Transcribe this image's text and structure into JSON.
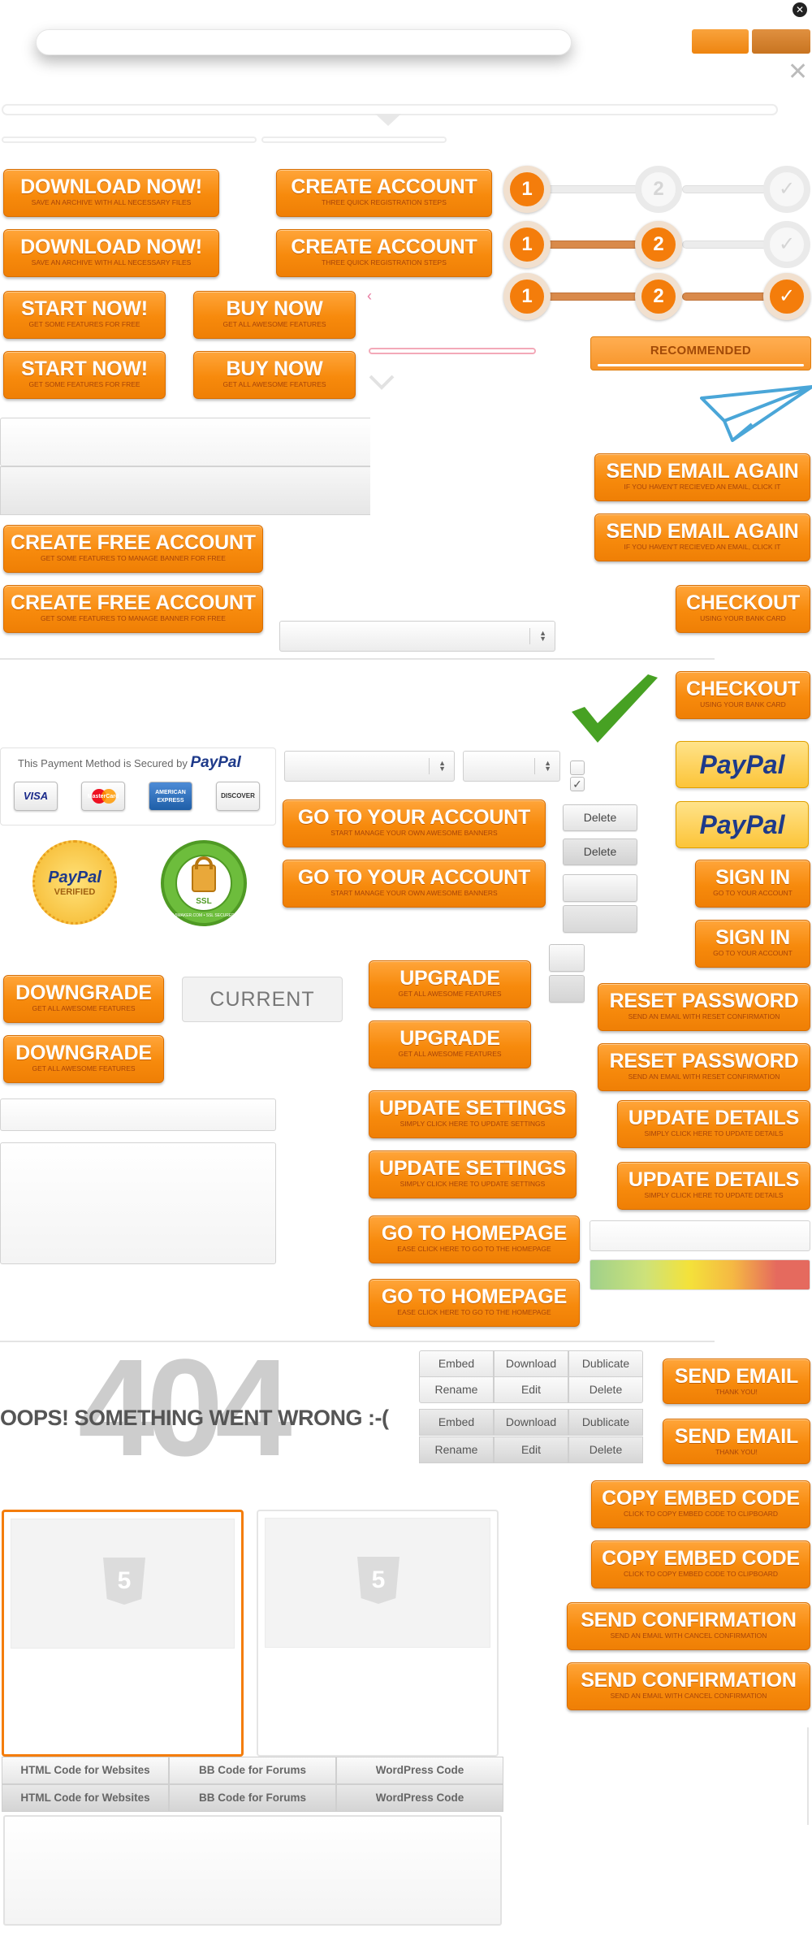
{
  "icons": {
    "close_round": "close-circle-icon",
    "close_x": "close-icon",
    "check": "check-icon",
    "plane": "paper-plane-icon",
    "html5": "html5-icon"
  },
  "colors": {
    "accent": "#f78a0c",
    "sub": "#a7440a",
    "check": "#47a123",
    "paypal_blue": "#1e3a8a"
  },
  "buttons": {
    "download": {
      "label": "DOWNLOAD NOW!",
      "sub": "SAVE AN ARCHIVE WITH ALL NECESSARY FILES"
    },
    "create_account": {
      "label": "CREATE ACCOUNT",
      "sub": "THREE QUICK REGISTRATION STEPS"
    },
    "start_now": {
      "label": "START NOW!",
      "sub": "GET SOME FEATURES FOR FREE"
    },
    "buy_now": {
      "label": "BUY NOW",
      "sub": "GET ALL AWESOME FEATURES"
    },
    "create_free": {
      "label": "CREATE FREE ACCOUNT",
      "sub": "GET SOME FEATURES TO MANAGE BANNER FOR FREE"
    },
    "send_again": {
      "label": "SEND EMAIL AGAIN",
      "sub": "IF YOU HAVEN'T RECIEVED AN EMAIL, CLICK IT"
    },
    "checkout": {
      "label": "CHECKOUT",
      "sub": "USING YOUR BANK CARD"
    },
    "go_account": {
      "label": "GO TO YOUR ACCOUNT",
      "sub": "START MANAGE YOUR OWN AWESOME BANNERS"
    },
    "sign_in": {
      "label": "SIGN IN",
      "sub": "GO TO YOUR ACCOUNT"
    },
    "downgrade": {
      "label": "DOWNGRADE",
      "sub": "GET ALL AWESOME FEATURES"
    },
    "upgrade": {
      "label": "UPGRADE",
      "sub": "GET ALL AWESOME FEATURES"
    },
    "reset": {
      "label": "RESET PASSWORD",
      "sub": "SEND AN EMAIL WITH RESET CONFIRMATION"
    },
    "update_settings": {
      "label": "UPDATE SETTINGS",
      "sub": "SIMPLY CLICK HERE TO UPDATE SETTINGS"
    },
    "update_details": {
      "label": "UPDATE DETAILS",
      "sub": "SIMPLY CLICK HERE TO UPDATE DETAILS"
    },
    "homepage": {
      "label": "GO TO HOMEPAGE",
      "sub": "EASE CLICK HERE TO GO TO THE HOMEPAGE"
    },
    "send_email": {
      "label": "SEND EMAIL",
      "sub": "THANK YOU!"
    },
    "copy_embed": {
      "label": "COPY EMBED CODE",
      "sub": "CLICK TO COPY EMBED CODE TO CLIPBOARD"
    },
    "send_conf": {
      "label": "SEND CONFIRMATION",
      "sub": "SEND AN EMAIL WITH CANCEL CONFIRMATION"
    },
    "recommended": "RECOMMENDED",
    "current": "CURRENT",
    "delete": "Delete"
  },
  "steps": {
    "one": "1",
    "two": "2"
  },
  "payment": {
    "secured_text": "This Payment Method is Secured by",
    "paypal": "PayPal",
    "verified": "VERIFIED",
    "cards": [
      "VISA",
      "MasterCard",
      "AMERICAN EXPRESS",
      "DISCOVER"
    ],
    "ssl": "SSL",
    "ssl_ring": "HTML5MAKER.COM • SSL SECURED SERVER"
  },
  "error": {
    "code": "404",
    "message": "OOPS! SOMETHING WENT WRONG :-("
  },
  "actions": {
    "row1": [
      "Embed",
      "Download",
      "Dublicate"
    ],
    "row2": [
      "Rename",
      "Edit",
      "Delete"
    ]
  },
  "code_tabs": [
    "HTML Code for Websites",
    "BB Code for Forums",
    "WordPress Code"
  ],
  "thumb_icon_label": "5"
}
